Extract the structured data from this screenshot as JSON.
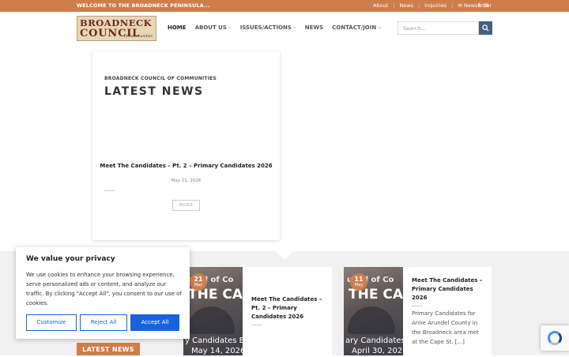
{
  "topbar": {
    "welcome": "WELCOME TO THE BROADNECK PENINSULA...",
    "links": [
      "About",
      "News",
      "Inquiries",
      "Newsletter"
    ],
    "newsletter_icon": "envelope-icon",
    "social_icons": [
      "facebook-icon",
      "email-icon"
    ],
    "facebook_glyph": "f",
    "email_glyph": "✉"
  },
  "logo": {
    "line1": "BROADNECK",
    "line2": "COUNCIL",
    "line3": "of Communities"
  },
  "nav": {
    "items": [
      {
        "label": "HOME",
        "dropdown": false
      },
      {
        "label": "ABOUT US",
        "dropdown": true
      },
      {
        "label": "ISSUES/ACTIONS",
        "dropdown": true
      },
      {
        "label": "NEWS",
        "dropdown": false
      },
      {
        "label": "CONTACT/JOIN",
        "dropdown": true
      }
    ],
    "chevron": "⌵"
  },
  "search": {
    "placeholder": "Search...",
    "button_icon": "search-icon"
  },
  "featured": {
    "kicker": "BROADNECK COUNCIL OF COMMUNITIES",
    "heading": "LATEST NEWS",
    "post_title": "Meet The Candidates – Pt. 2 – Primary Candidates 2026",
    "date": "May 21, 2026",
    "more_label": "MORE"
  },
  "posts": [
    {
      "day": "21",
      "month": "May",
      "title_lines": [
        "Meet The Candidates –",
        "Pt. 2 – Primary",
        "Candidates 2026"
      ],
      "image_text": [
        "uncil of Co",
        "THE CANDI",
        "y Candidates E",
        "May 14, 2026"
      ]
    },
    {
      "day": "11",
      "month": "May",
      "title_lines": [
        "Meet The Candidates –",
        "Primary Candidates",
        "2026"
      ],
      "excerpt_lines": [
        "Primary Candidates for",
        "Anne Arundel County in",
        "the Broadneck area met",
        "at the Cape St. [...]"
      ],
      "image_text": [
        "uncil of Co",
        "THE CANDI",
        "ary Candidates E",
        "April 30, 2026"
      ]
    }
  ],
  "latest_button": "LATEST NEWS",
  "privacy": {
    "title": "We value your privacy",
    "text": "We use cookies to enhance your browsing experience, serve personalized ads or content, and analyze our traffic. By clicking \"Accept All\", you consent to our use of cookies.",
    "customize": "Customize",
    "reject": "Reject All",
    "accept": "Accept All"
  },
  "colors": {
    "accent": "#d07d4c",
    "search_button": "#446084",
    "consent_blue": "#1863dc"
  }
}
